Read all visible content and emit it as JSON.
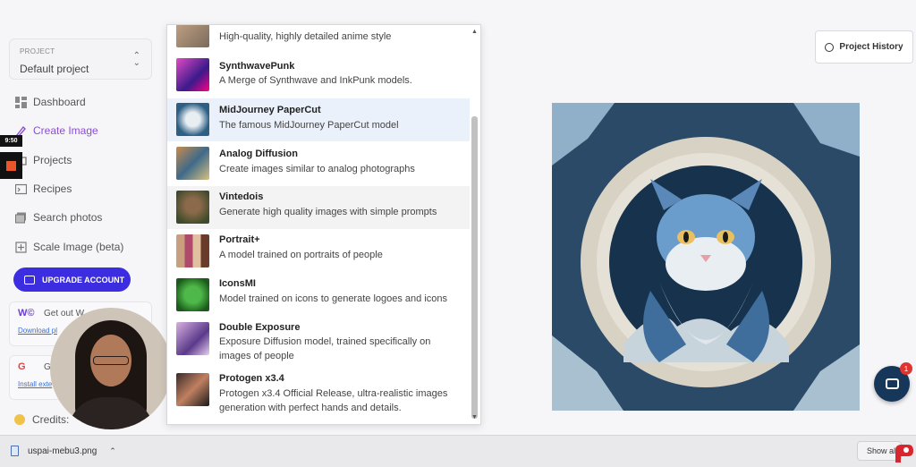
{
  "sidebar": {
    "project_label": "PROJECT",
    "project_name": "Default project",
    "nav": [
      {
        "label": "Dashboard",
        "icon": "dashboard-icon"
      },
      {
        "label": "Create Image",
        "icon": "brush-icon",
        "active": true
      },
      {
        "label": "Projects",
        "icon": "folder-icon"
      },
      {
        "label": "Recipes",
        "icon": "terminal-icon"
      },
      {
        "label": "Search photos",
        "icon": "photos-icon"
      },
      {
        "label": "Scale Image (beta)",
        "icon": "scale-icon"
      }
    ],
    "upgrade_label": "UPGRADE ACCOUNT",
    "promo1": {
      "text": "Get out W",
      "link": "Download pl"
    },
    "promo2": {
      "text": "G",
      "link": "Install exte"
    },
    "credits_label": "Credits:"
  },
  "overlay": {
    "timer": "9:50"
  },
  "models": [
    {
      "name": "",
      "desc": "High-quality, highly detailed anime style"
    },
    {
      "name": "SynthwavePunk",
      "desc": "A Merge of Synthwave and InkPunk models."
    },
    {
      "name": "MidJourney PaperCut",
      "desc": "The famous MidJourney PaperCut model"
    },
    {
      "name": "Analog Diffusion",
      "desc": "Create images similar to analog photographs"
    },
    {
      "name": "Vintedois",
      "desc": "Generate high quality images with simple prompts"
    },
    {
      "name": "Portrait+",
      "desc": "A model trained on portraits of people"
    },
    {
      "name": "IconsMI",
      "desc": "Model trained on icons to generate logoes and icons"
    },
    {
      "name": "Double Exposure",
      "desc_line1": "Exposure Diffusion model, trained specifically on",
      "desc_line2": "images of people"
    },
    {
      "name": "Protogen x3.4",
      "desc_line1": "Protogen x3.4 Official Release, ultra-realistic images",
      "desc_line2": "generation with perfect hands and details."
    }
  ],
  "main": {
    "history_label": "Project History",
    "chat_badge": "1"
  },
  "downloads": {
    "file_name": "uspai-mebu3.png",
    "show_all": "Show all"
  },
  "colors": {
    "accent": "#8a4fd4",
    "upgrade": "#3c2ee0",
    "highlight_row": "#eaf1fb",
    "chat": "#16365a"
  }
}
